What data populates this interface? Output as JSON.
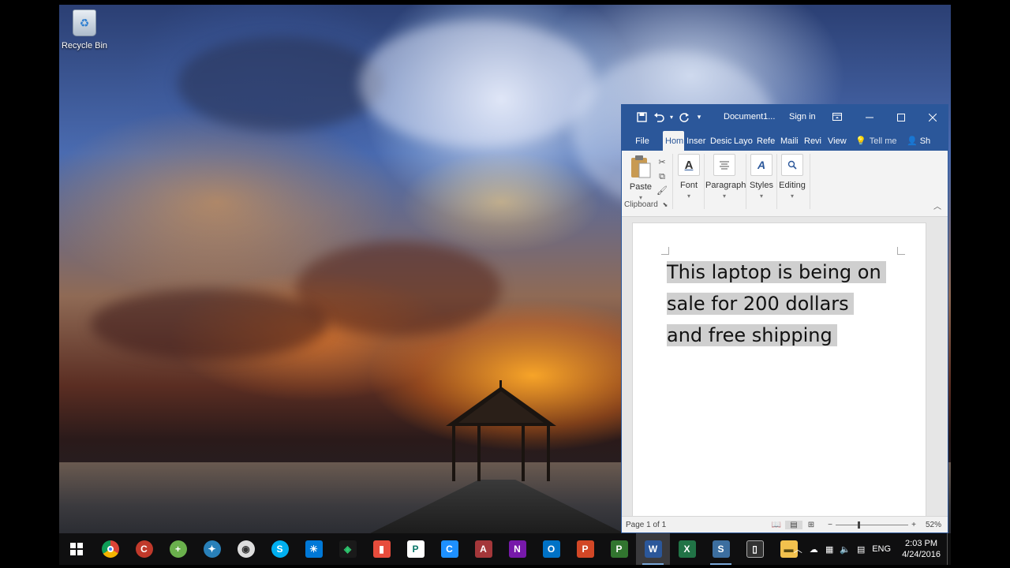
{
  "desktop": {
    "recycle_bin_label": "Recycle Bin"
  },
  "word": {
    "title": "Document1...",
    "sign_in": "Sign in",
    "tabs": [
      "File",
      "Hom",
      "Inser",
      "Desic",
      "Layo",
      "Refe",
      "Maili",
      "Revi",
      "View"
    ],
    "tell_me": "Tell me",
    "share": "Sh",
    "ribbon": {
      "paste": "Paste",
      "clipboard": "Clipboard",
      "font": "Font",
      "paragraph": "Paragraph",
      "styles": "Styles",
      "editing": "Editing"
    },
    "document_lines": [
      "This laptop is being on",
      "sale for 200 dollars",
      "and free shipping"
    ],
    "status": {
      "page": "Page 1 of 1",
      "zoom": "52%"
    }
  },
  "taskbar": {
    "apps": [
      "start",
      "chrome",
      "ccleaner",
      "app-green",
      "settings-blue",
      "webcam",
      "skype",
      "sun-app",
      "diamond-app",
      "bookmark-app",
      "publisher",
      "c-app",
      "access",
      "onenote",
      "outlook",
      "powerpoint",
      "project",
      "word",
      "excel",
      "sublime-app",
      "phone-app",
      "file-explorer"
    ],
    "tray": {
      "language": "ENG",
      "time": "2:03 PM",
      "date": "4/24/2016"
    }
  },
  "colors": {
    "word_blue": "#2b579a",
    "selection_gray": "#cfcfcf"
  }
}
